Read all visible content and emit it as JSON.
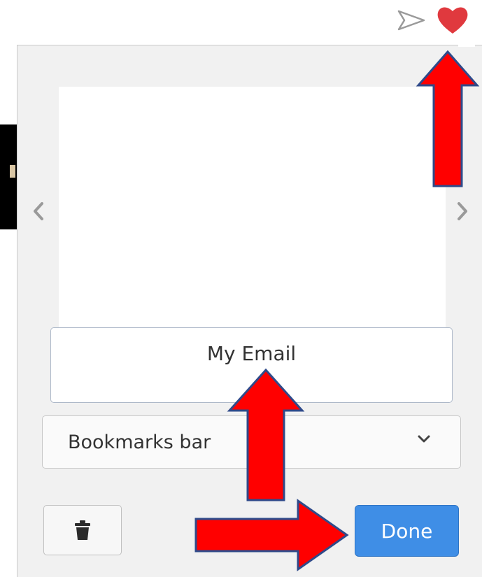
{
  "bookmark_popup": {
    "title_value": "My Email",
    "folder_selected": "Bookmarks bar",
    "done_label": "Done"
  },
  "icons": {
    "send": "send-icon",
    "favorite": "heart-icon",
    "prev": "chevron-left-icon",
    "next": "chevron-right-icon",
    "dropdown": "chevron-down-icon",
    "delete": "trash-icon"
  },
  "colors": {
    "heart": "#e0393e",
    "done_button": "#3f8ee6",
    "annotation_arrow": "#ff0000",
    "annotation_outline": "#2f4a8a"
  }
}
